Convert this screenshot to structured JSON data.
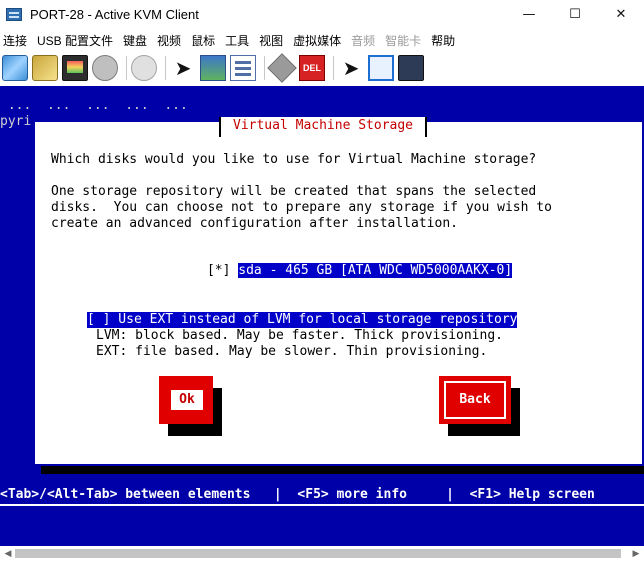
{
  "window": {
    "title": "PORT-28 - Active KVM Client",
    "controls": {
      "minimize": "—",
      "maximize": "☐",
      "close": "✕"
    }
  },
  "menubar": {
    "items": [
      {
        "label": "连接",
        "enabled": true
      },
      {
        "label": "USB 配置文件",
        "enabled": true
      },
      {
        "label": "键盘",
        "enabled": true
      },
      {
        "label": "视频",
        "enabled": true
      },
      {
        "label": "鼠标",
        "enabled": true
      },
      {
        "label": "工具",
        "enabled": true
      },
      {
        "label": "视图",
        "enabled": true
      },
      {
        "label": "虚拟媒体",
        "enabled": true
      },
      {
        "label": "音频",
        "enabled": false
      },
      {
        "label": "智能卡",
        "enabled": false
      },
      {
        "label": "帮助",
        "enabled": true
      }
    ]
  },
  "toolbar": {
    "icons": [
      "connect-icon",
      "session-icon",
      "video-icon",
      "capture-icon",
      "media-icon",
      "disc-icon",
      "pointer-icon",
      "sync-icon",
      "settings-icon",
      "keyboard-icon",
      "ctrl-alt-del-icon",
      "single-cursor-icon",
      "fullscreen-icon",
      "macro-icon"
    ],
    "del_label": "DEL"
  },
  "kvm": {
    "background_fragments": [
      " ...  ...  ...  ...  ...",
      "pyri"
    ],
    "dialog": {
      "title": "Virtual Machine Storage",
      "question": "Which disks would you like to use for Virtual Machine storage?",
      "description": [
        "One storage repository will be created that spans the selected",
        "disks.  You can choose not to prepare any storage if you wish to",
        "create an advanced configuration after installation."
      ],
      "disk": {
        "checkbox": "[*]",
        "label": "sda - 465 GB [ATA WDC WD5000AAKX-0]"
      },
      "ext_option": "[ ] Use EXT instead of LVM for local storage repository",
      "lvm_note": "LVM: block based. May be faster. Thick provisioning.",
      "ext_note": "EXT: file based. May be slower. Thin provisioning.",
      "ok_label": "Ok",
      "back_label": "Back"
    },
    "status_bar": "<Tab>/<Alt-Tab> between elements   |  <F5> more info     |  <F1> Help screen"
  },
  "colors": {
    "console_blue": "#0000a8",
    "selection_blue": "#0000c8",
    "button_red": "#e00000",
    "title_red": "#c40000"
  }
}
